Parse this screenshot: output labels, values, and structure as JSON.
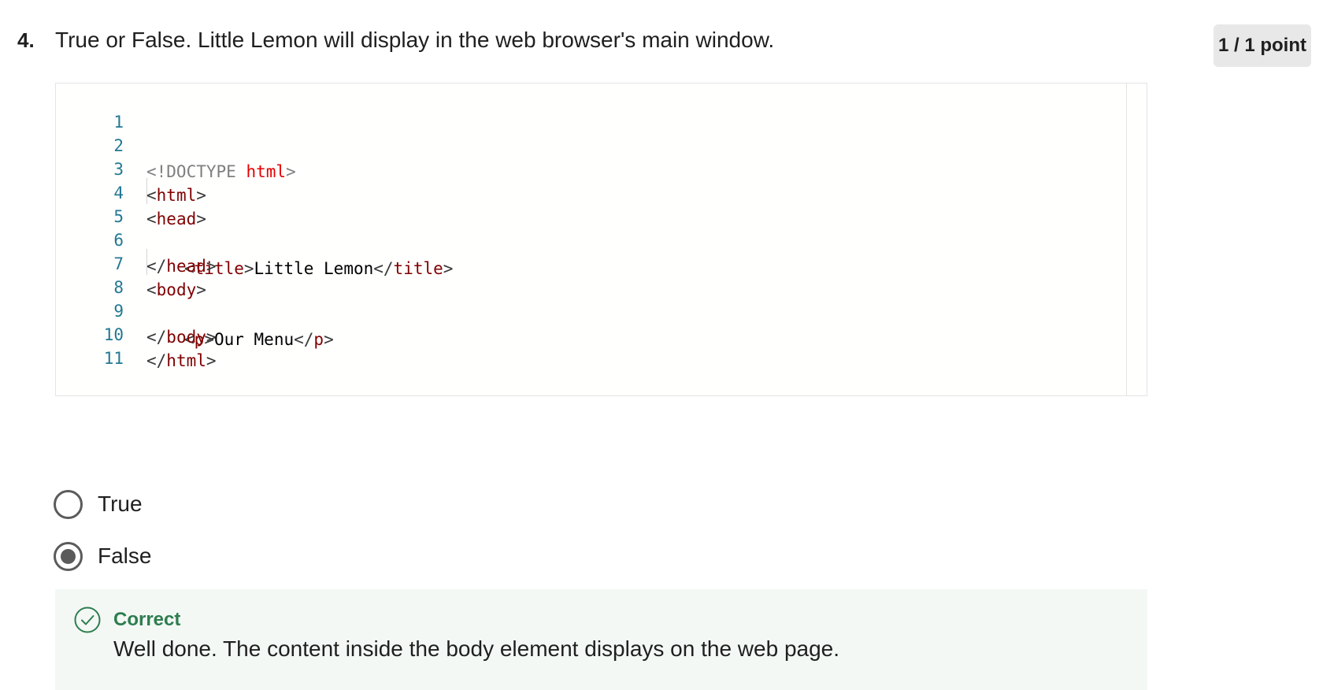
{
  "question": {
    "number": "4.",
    "text": "True or False. Little Lemon will display in the web browser's main window.",
    "points": "1 / 1 point"
  },
  "code": {
    "lines": [
      {
        "no": "1"
      },
      {
        "no": "2",
        "t1": "<!DOCTYPE ",
        "t2": "html",
        "t3": ">"
      },
      {
        "no": "3",
        "t1": "<",
        "t2": "html",
        "t3": ">"
      },
      {
        "no": "4",
        "t1": "<",
        "t2": "head",
        "t3": ">"
      },
      {
        "no": "5",
        "t1": "<",
        "t2": "title",
        "t3": ">",
        "t4": "Little Lemon",
        "t5": "</",
        "t6": "title",
        "t7": ">"
      },
      {
        "no": "6",
        "t1": "</",
        "t2": "head",
        "t3": ">"
      },
      {
        "no": "7",
        "t1": "<",
        "t2": "body",
        "t3": ">"
      },
      {
        "no": "8",
        "t1": "<",
        "t2": "p",
        "t3": ">",
        "t4": "Our Menu",
        "t5": "</",
        "t6": "p",
        "t7": ">"
      },
      {
        "no": "9",
        "t1": "</",
        "t2": "body",
        "t3": ">"
      },
      {
        "no": "10",
        "t1": "</",
        "t2": "html",
        "t3": ">"
      },
      {
        "no": "11"
      }
    ]
  },
  "options": [
    {
      "label": "True",
      "selected": false
    },
    {
      "label": "False",
      "selected": true
    }
  ],
  "feedback": {
    "status": "Correct",
    "message": "Well done. The content inside the body element displays on the web page.",
    "icon": "check-circle-icon",
    "color": "#2e7d4f"
  }
}
